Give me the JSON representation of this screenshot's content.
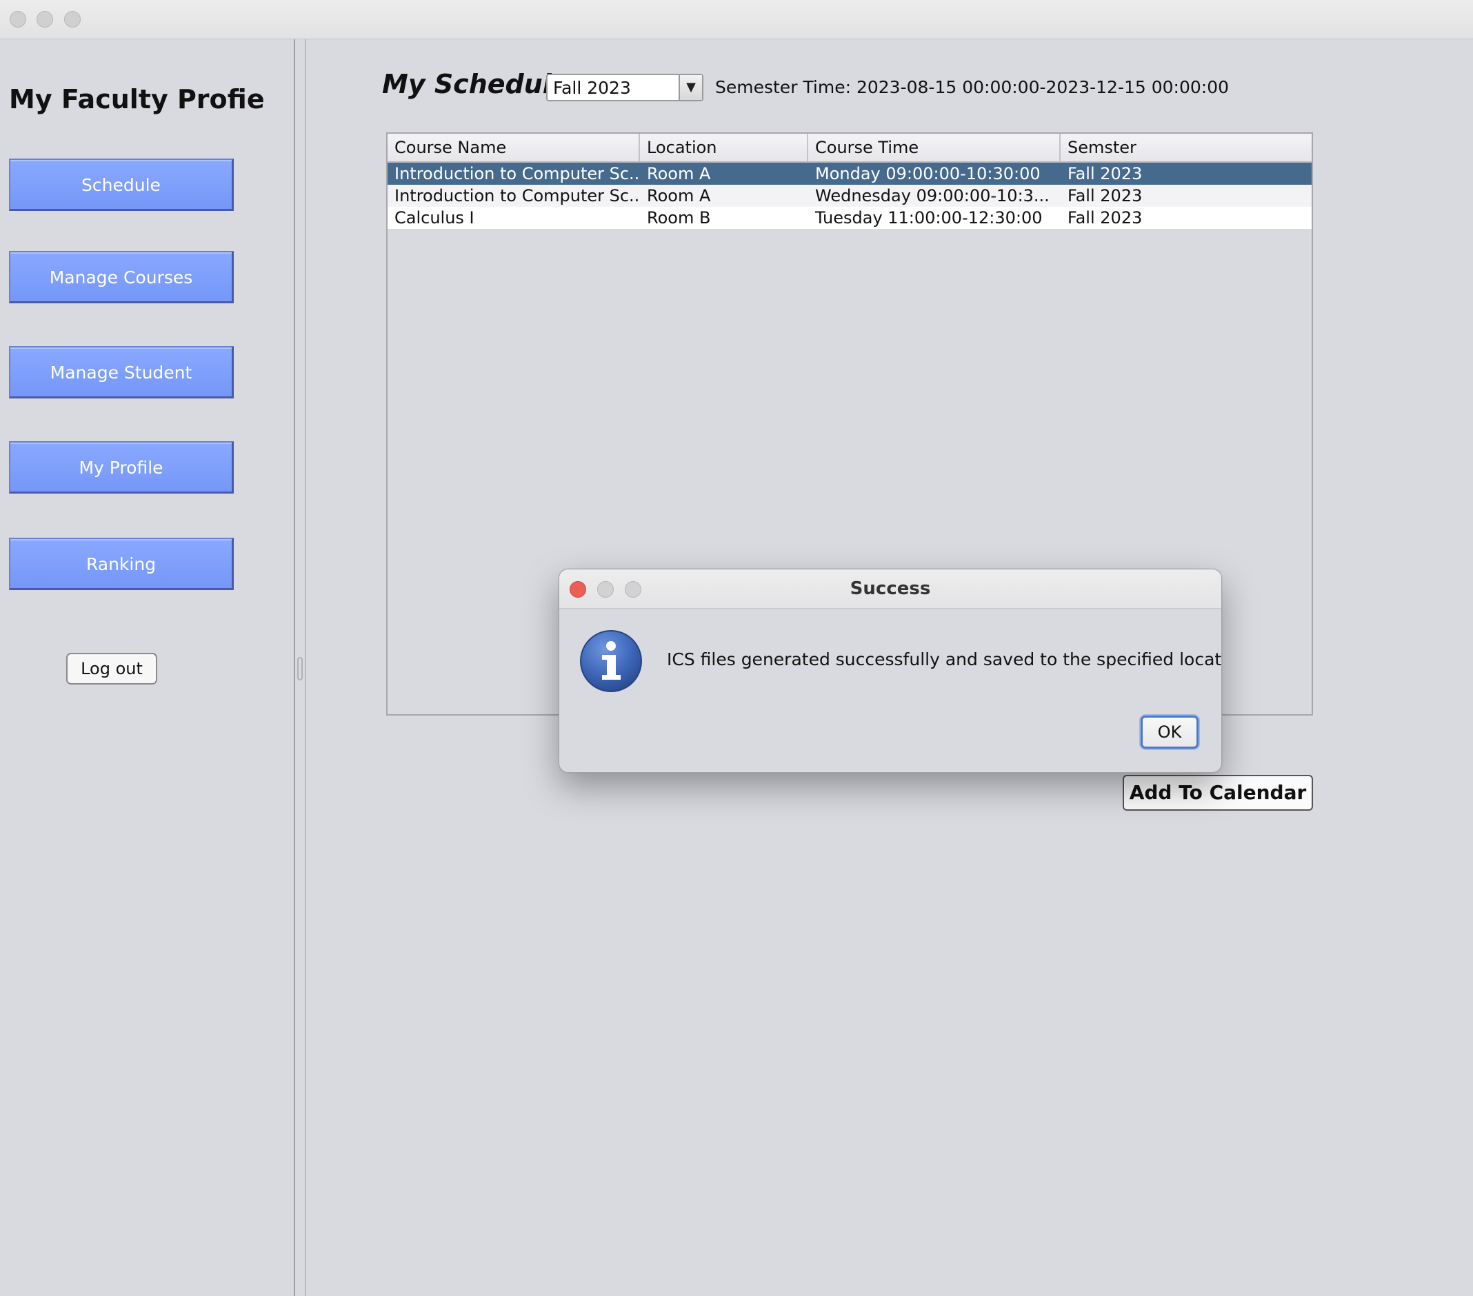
{
  "sidebar": {
    "title": "My Faculty Profie",
    "nav": {
      "schedule": "Schedule",
      "manage_courses": "Manage Courses",
      "manage_student": "Manage Student",
      "my_profile": "My Profile",
      "ranking": "Ranking"
    },
    "logout": "Log out"
  },
  "main": {
    "title": "My Schedule",
    "semester_selected": "Fall 2023",
    "semester_time": "Semester Time: 2023-08-15 00:00:00-2023-12-15 00:00:00",
    "table": {
      "columns": [
        "Course Name",
        "Location",
        "Course Time",
        "Semster"
      ],
      "rows": [
        [
          "Introduction to Computer Sc...",
          "Room A",
          "Monday 09:00:00-10:30:00",
          "Fall 2023"
        ],
        [
          "Introduction to Computer Sc...",
          "Room A",
          "Wednesday 09:00:00-10:3...",
          "Fall 2023"
        ],
        [
          "Calculus I",
          "Room B",
          "Tuesday 11:00:00-12:30:00",
          "Fall 2023"
        ]
      ]
    },
    "add_to_calendar": "Add To Calendar"
  },
  "dialog": {
    "title": "Success",
    "message": "ICS files generated successfully and saved to the specified location.",
    "ok": "OK",
    "icon": "info-icon"
  },
  "colors": {
    "background": "#d9dae0",
    "nav_button": "#7e9ffb",
    "selected_row": "#456a8e",
    "close_red": "#ec5f57"
  }
}
